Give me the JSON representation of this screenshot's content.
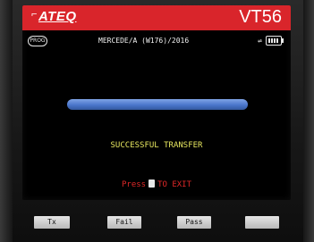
{
  "device": {
    "brand": "ATEQ",
    "model": "VT56"
  },
  "info_bar": {
    "mode_icon": "prog-icon",
    "vehicle": "MERCEDE/A (W176)/2016",
    "usb_icon": "usb-icon",
    "battery_icon": "battery-icon"
  },
  "progress": {
    "fraction": 1.0
  },
  "status_text": "SUCCESSFUL TRANSFER",
  "exit_prompt": {
    "press": "Press",
    "to_exit": "TO EXIT",
    "key_icon": "back-key-icon"
  },
  "softkeys": [
    {
      "label": "Tx"
    },
    {
      "label": "Fail"
    },
    {
      "label": "Pass"
    },
    {
      "label": ""
    }
  ],
  "colors": {
    "title_bar": "#d9252b",
    "progress": "#4a76cc",
    "status": "#e8e860",
    "exit": "#e02828"
  }
}
